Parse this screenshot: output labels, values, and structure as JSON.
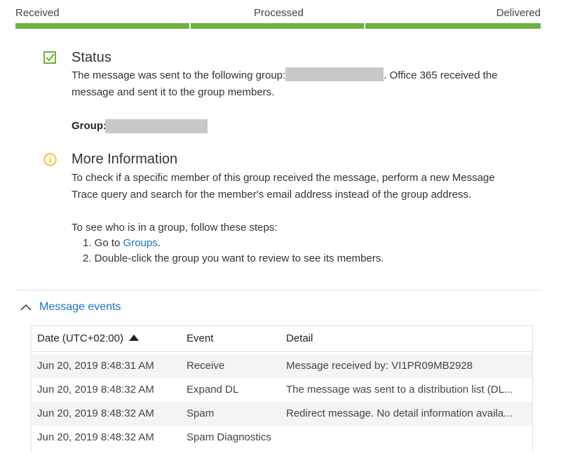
{
  "progress": {
    "stages": [
      "Received",
      "Processed",
      "Delivered"
    ],
    "bar_color": "#6fb23f"
  },
  "status": {
    "icon": "checkbox-check-icon",
    "title": "Status",
    "text_before": "The message was sent to the following group:",
    "text_after": ". Office 365 received the",
    "line2": "message and sent it to the group members.",
    "group_label": "Group:"
  },
  "more_info": {
    "icon": "info-circle-icon",
    "title": "More Information",
    "line1": "To check if a specific member of this group received the message, perform a new Message",
    "line2": "Trace query and search for the member's email address instead of the group address.",
    "steps_intro": "To see who is in a group, follow these steps:",
    "step1_prefix": "1. Go to ",
    "step1_link": "Groups",
    "step1_suffix": ".",
    "step2": "2. Double-click the group you want to review to see its members."
  },
  "events": {
    "toggle_icon": "chevron-up-icon",
    "title": "Message events",
    "columns": {
      "date": "Date (UTC+02:00)",
      "event": "Event",
      "detail": "Detail"
    },
    "sort": "ascending",
    "rows": [
      {
        "date": "Jun 20, 2019 8:48:31 AM",
        "event": "Receive",
        "detail": "Message received by: VI1PR09MB2928"
      },
      {
        "date": "Jun 20, 2019 8:48:32 AM",
        "event": "Expand DL",
        "detail": "The message was sent to a distribution list (DL..."
      },
      {
        "date": "Jun 20, 2019 8:48:32 AM",
        "event": "Spam",
        "detail": "Redirect message. No detail information availa..."
      },
      {
        "date": "Jun 20, 2019 8:48:32 AM",
        "event": "Spam Diagnostics",
        "detail": ""
      }
    ]
  },
  "colors": {
    "accent": "#1a73c6",
    "success": "#6fb23f",
    "info": "#f0b400"
  }
}
